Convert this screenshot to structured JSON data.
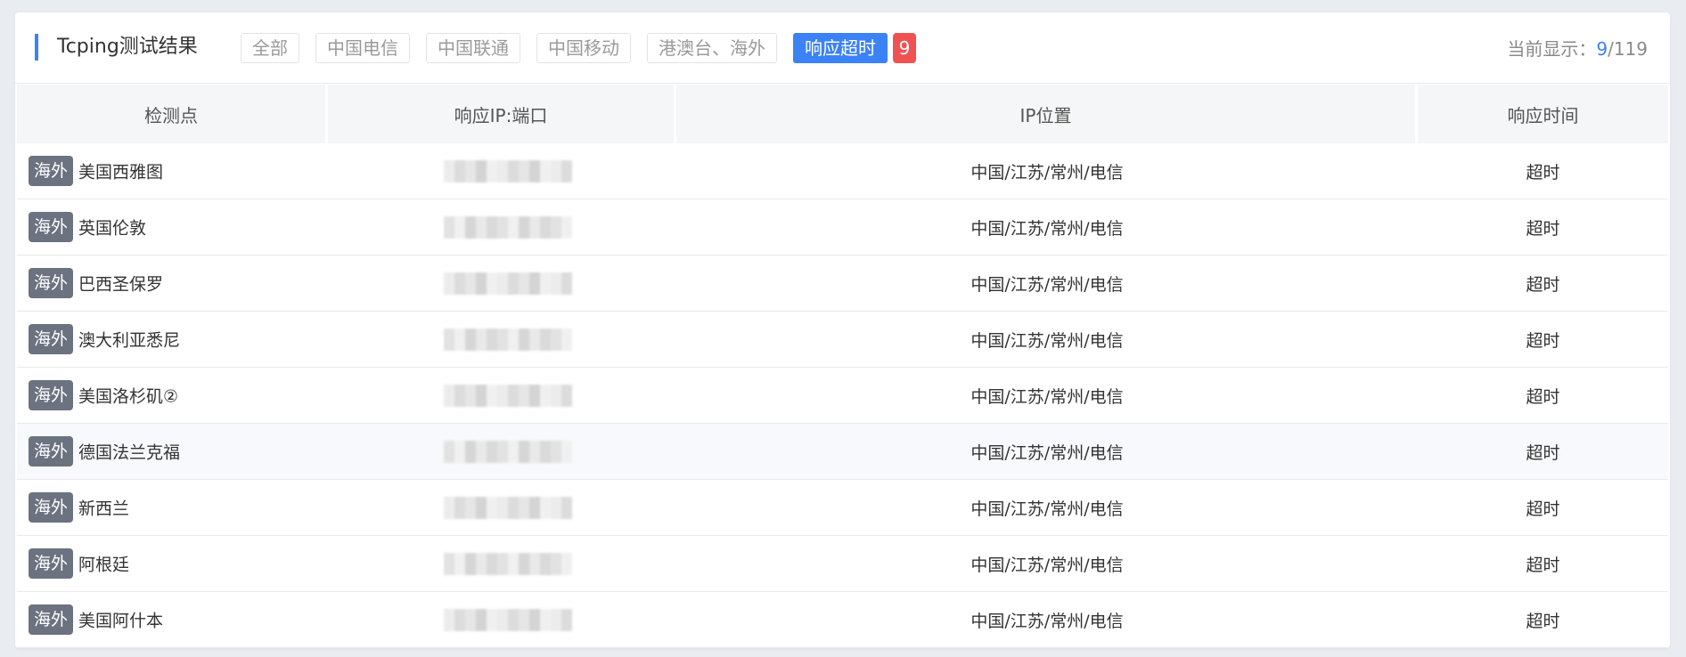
{
  "header": {
    "title": "Tcping测试结果",
    "tabs": [
      {
        "label": "全部"
      },
      {
        "label": "中国电信"
      },
      {
        "label": "中国联通"
      },
      {
        "label": "中国移动"
      },
      {
        "label": "港澳台、海外"
      },
      {
        "label": "响应超时",
        "active": true,
        "badge": "9"
      }
    ],
    "counter": {
      "prefix": "当前显示：",
      "current": "9",
      "total": "/119"
    }
  },
  "table": {
    "columns": [
      "检测点",
      "响应IP:端口",
      "IP位置",
      "响应时间"
    ],
    "rows": [
      {
        "tag": "海外",
        "node": "美国西雅图",
        "location": "中国/江苏/常州/电信",
        "time": "超时"
      },
      {
        "tag": "海外",
        "node": "英国伦敦",
        "location": "中国/江苏/常州/电信",
        "time": "超时"
      },
      {
        "tag": "海外",
        "node": "巴西圣保罗",
        "location": "中国/江苏/常州/电信",
        "time": "超时"
      },
      {
        "tag": "海外",
        "node": "澳大利亚悉尼",
        "location": "中国/江苏/常州/电信",
        "time": "超时"
      },
      {
        "tag": "海外",
        "node": "美国洛杉矶②",
        "location": "中国/江苏/常州/电信",
        "time": "超时"
      },
      {
        "tag": "海外",
        "node": "德国法兰克福",
        "location": "中国/江苏/常州/电信",
        "time": "超时"
      },
      {
        "tag": "海外",
        "node": "新西兰",
        "location": "中国/江苏/常州/电信",
        "time": "超时"
      },
      {
        "tag": "海外",
        "node": "阿根廷",
        "location": "中国/江苏/常州/电信",
        "time": "超时"
      },
      {
        "tag": "海外",
        "node": "美国阿什本",
        "location": "中国/江苏/常州/电信",
        "time": "超时"
      }
    ]
  },
  "colors": {
    "accent": "#3b82f6",
    "timeout": "#f05252",
    "tag_bg": "#6b7280"
  }
}
